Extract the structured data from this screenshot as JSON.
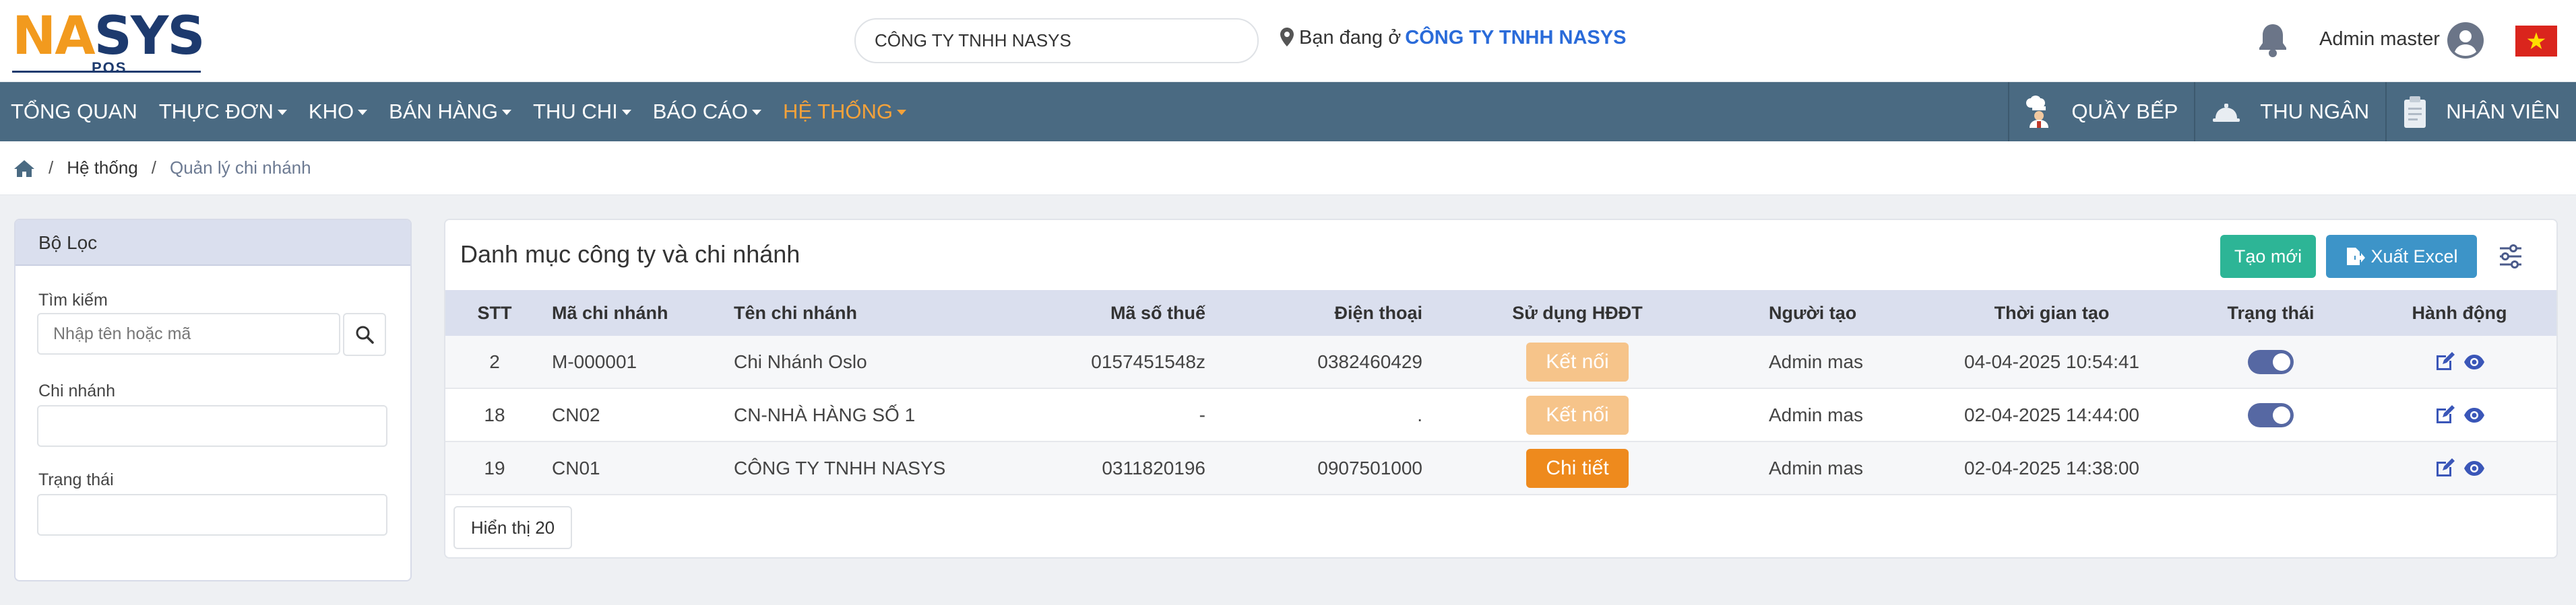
{
  "header": {
    "logo": {
      "word_left": "NA",
      "word_right": "SYS",
      "sub": "POS"
    },
    "company_select_value": "CÔNG TY TNHH NASYS",
    "location_prefix": "Bạn đang ở",
    "location_company": "CÔNG TY TNHH NASYS",
    "admin_name": "Admin master",
    "icons": [
      "bell-icon",
      "user-avatar-icon",
      "vietnam-flag-icon",
      "map-pin-icon"
    ]
  },
  "nav": {
    "items": [
      {
        "label": "TỔNG QUAN",
        "dropdown": false,
        "active": false
      },
      {
        "label": "THỰC ĐƠN",
        "dropdown": true,
        "active": false
      },
      {
        "label": "KHO",
        "dropdown": true,
        "active": false
      },
      {
        "label": "BÁN HÀNG",
        "dropdown": true,
        "active": false
      },
      {
        "label": "THU CHI",
        "dropdown": true,
        "active": false
      },
      {
        "label": "BÁO CÁO",
        "dropdown": true,
        "active": false
      },
      {
        "label": "HỆ THỐNG",
        "dropdown": true,
        "active": true
      }
    ],
    "right_buttons": [
      {
        "label": "QUẦY BẾP",
        "icon": "chef-icon"
      },
      {
        "label": "THU NGÂN",
        "icon": "cashier-bell-icon"
      },
      {
        "label": "NHÂN VIÊN",
        "icon": "clipboard-icon"
      }
    ]
  },
  "breadcrumb": {
    "home_icon": "home-icon",
    "level1": "Hệ thống",
    "current": "Quản lý chi nhánh",
    "separator": "/"
  },
  "filter": {
    "title": "Bộ Lọc",
    "search_label": "Tìm kiếm",
    "search_placeholder": "Nhập tên hoặc mã",
    "search_value": "",
    "branch_label": "Chi nhánh",
    "branch_value": "",
    "status_label": "Trạng thái",
    "status_value": ""
  },
  "main": {
    "title": "Danh mục công ty và chi nhánh",
    "create_label": "Tạo mới",
    "excel_label": "Xuất Excel",
    "show_label": "Hiển thị 20",
    "columns": {
      "stt": "STT",
      "code": "Mã chi nhánh",
      "name": "Tên chi nhánh",
      "tax": "Mã số thuế",
      "phone": "Điện thoại",
      "einvoice": "Sử dụng HĐĐT",
      "creator": "Người tạo",
      "created_at": "Thời gian tạo",
      "status": "Trạng thái",
      "action": "Hành động"
    },
    "rows": [
      {
        "stt": "2",
        "code": "M-000001",
        "name": "Chi Nhánh Oslo",
        "tax": "0157451548z",
        "phone": "0382460429",
        "einvoice": "Kết nối",
        "einvoice_style": "light",
        "creator": "Admin mas",
        "created_at": "04-04-2025 10:54:41",
        "status_on": true
      },
      {
        "stt": "18",
        "code": "CN02",
        "name": "CN-NHÀ HÀNG SỐ 1",
        "tax": "-",
        "phone": ".",
        "einvoice": "Kết nối",
        "einvoice_style": "light",
        "creator": "Admin mas",
        "created_at": "02-04-2025 14:44:00",
        "status_on": true
      },
      {
        "stt": "19",
        "code": "CN01",
        "name": "CÔNG TY TNHH NASYS",
        "tax": "0311820196",
        "phone": "0907501000",
        "einvoice": "Chi tiết",
        "einvoice_style": "dark",
        "creator": "Admin mas",
        "created_at": "02-04-2025 14:38:00",
        "status_on": false
      }
    ]
  },
  "colors": {
    "nav_bg": "#4a6a82",
    "nav_active": "#f5a23a",
    "create_btn": "#2db596",
    "excel_btn": "#3d94c8",
    "toggle_on": "#5668a3",
    "pill_light": "#f6c48a",
    "pill_dark": "#ee8a1d",
    "location_company": "#2a6bd9"
  }
}
